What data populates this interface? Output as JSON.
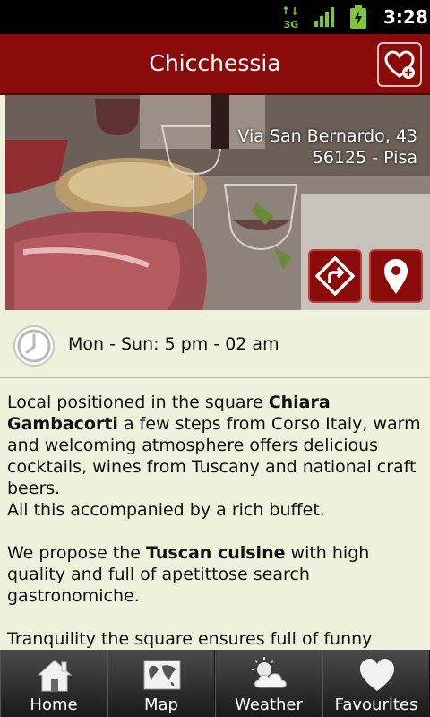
{
  "status_bar": {
    "network": "3G",
    "time": "3:28"
  },
  "header": {
    "title": "Chicchessia"
  },
  "hero": {
    "address_line1": "Via San Bernardo, 43",
    "address_line2": "56125 - Pisa"
  },
  "hours": {
    "text": "Mon - Sun: 5 pm - 02 am"
  },
  "description": {
    "p1_a": "Local positioned in the square ",
    "p1_b": "Chiara Gambacorti",
    "p1_c": " a few steps from Corso Italy, warm and welcoming atmosphere offers delicious cocktails, wines from Tuscany and national craft beers.",
    "p1_d": "All this accompanied by a rich buffet.",
    "p2_a": "We propose the ",
    "p2_b": "Tuscan cuisine",
    "p2_c": " with high quality and full of apetittose search gastronomiche.",
    "p3": "Tranquility the square ensures full of funny"
  },
  "nav": {
    "home": "Home",
    "map": "Map",
    "weather": "Weather",
    "favourites": "Favourites"
  },
  "colors": {
    "primary": "#8b0a0a",
    "background": "#eef1dc"
  },
  "icons": [
    "3g-icon",
    "signal-icon",
    "battery-icon",
    "heart-add-icon",
    "directions-icon",
    "map-pin-icon",
    "clock-icon",
    "home-icon",
    "map-icon",
    "weather-icon",
    "heart-icon"
  ]
}
